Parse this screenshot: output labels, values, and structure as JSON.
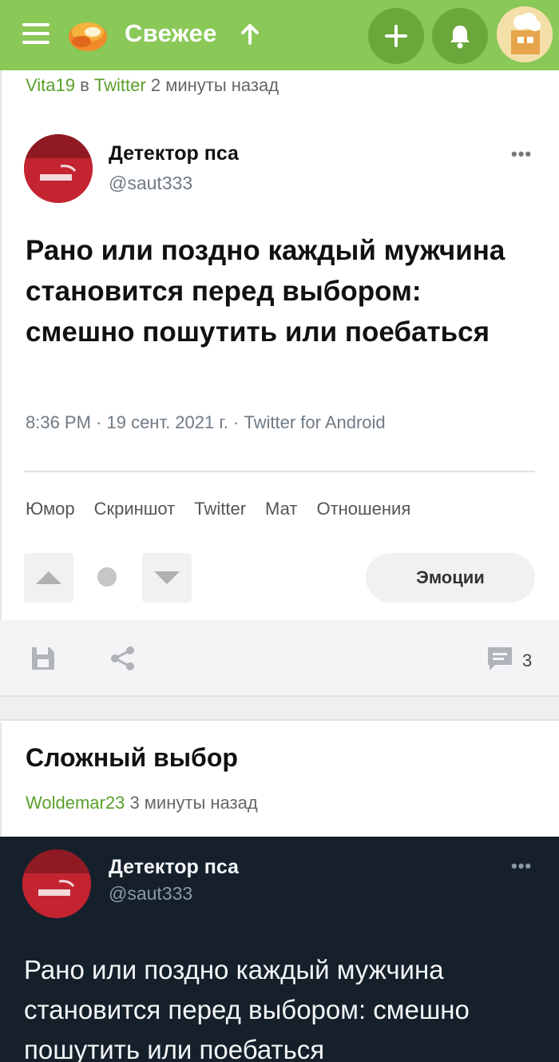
{
  "header": {
    "feed_label": "Свежее",
    "colors": {
      "bar": "#8ac858",
      "button": "#6aa83b"
    },
    "icons": [
      "menu-icon",
      "logo-icon",
      "arrow-up-icon",
      "plus-icon",
      "bell-icon",
      "avatar-icon"
    ]
  },
  "post1": {
    "author": "Vita19",
    "source_prefix": "в",
    "source": "Twitter",
    "time": "2 минуты назад",
    "tweet": {
      "name": "Детектор пса",
      "handle": "@saut333",
      "more": "•••",
      "text": "Рано или поздно каждый мужчина становится перед выбором: смешно пошутить или поебаться",
      "date": "8:36 PM · 19 сент. 2021 г. · Twitter for Android"
    },
    "tags": [
      "Юмор",
      "Скриншот",
      "Twitter",
      "Мат",
      "Отношения"
    ],
    "emotions_label": "Эмоции",
    "comment_count": "3"
  },
  "post2": {
    "title": "Сложный выбор",
    "author": "Woldemar23",
    "time": "3 минуты назад",
    "tweet": {
      "name": "Детектор пса",
      "handle": "@saut333",
      "more": "•••",
      "text": "Рано или поздно каждый мужчина становится перед выбором: смешно пошутить или поебаться"
    }
  }
}
